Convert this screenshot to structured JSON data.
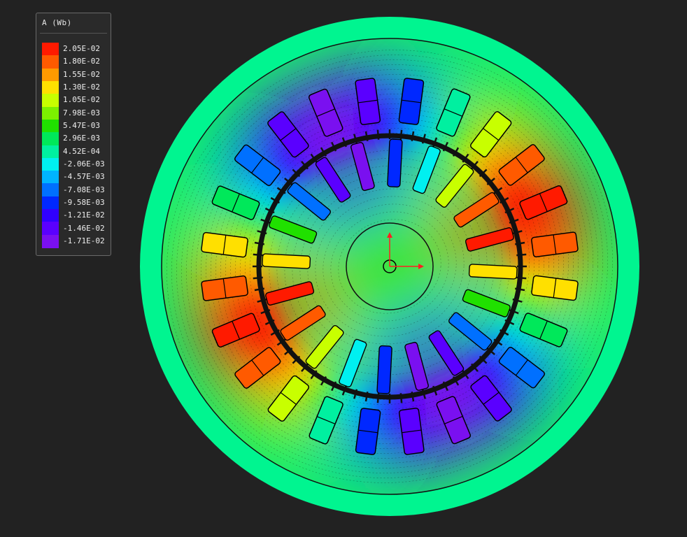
{
  "legend": {
    "title": "A (Wb)",
    "entries": [
      {
        "label": "2.05E-02",
        "color": "#ff1a00"
      },
      {
        "label": "1.80E-02",
        "color": "#ff5a00"
      },
      {
        "label": "1.55E-02",
        "color": "#ff9a00"
      },
      {
        "label": "1.30E-02",
        "color": "#ffe000"
      },
      {
        "label": "1.05E-02",
        "color": "#c8ff00"
      },
      {
        "label": "7.98E-03",
        "color": "#7cf000"
      },
      {
        "label": "5.47E-03",
        "color": "#20e000"
      },
      {
        "label": "2.96E-03",
        "color": "#00e85a"
      },
      {
        "label": "4.52E-04",
        "color": "#00f0a0"
      },
      {
        "label": "-2.06E-03",
        "color": "#00f0f0"
      },
      {
        "label": "-4.57E-03",
        "color": "#00b4ff"
      },
      {
        "label": "-7.08E-03",
        "color": "#0070ff"
      },
      {
        "label": "-9.58E-03",
        "color": "#0028ff"
      },
      {
        "label": "-1.21E-02",
        "color": "#3000ff"
      },
      {
        "label": "-1.46E-02",
        "color": "#5a00ff"
      },
      {
        "label": "-1.71E-02",
        "color": "#7a10f0"
      }
    ]
  },
  "field": {
    "outer_ring_color": "#00f590",
    "pole_pairs": 2,
    "stator_slots": 24,
    "rotor_slots": 20
  },
  "axes": {
    "x_color": "#ff2020",
    "y_color": "#ff2020"
  }
}
